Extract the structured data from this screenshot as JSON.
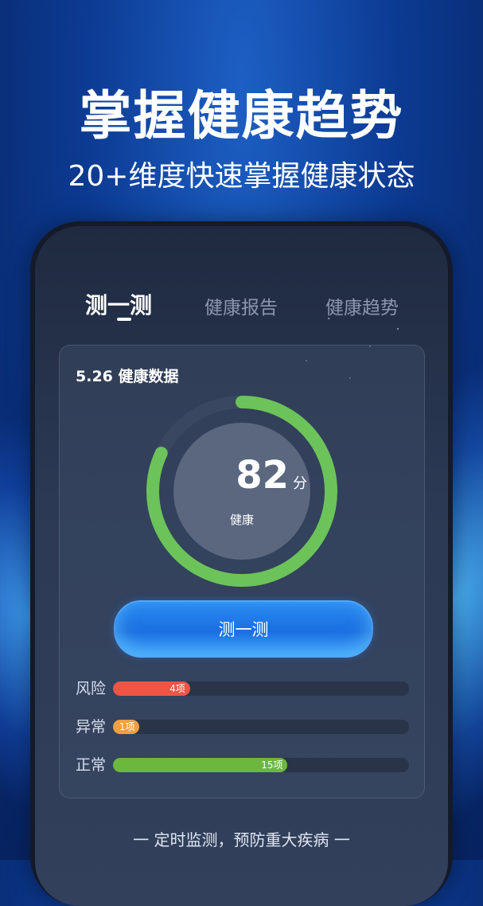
{
  "promo": {
    "headline": "掌握健康趋势",
    "subline": "20+维度快速掌握健康状态"
  },
  "tabs": [
    {
      "label": "测一测",
      "active": true
    },
    {
      "label": "健康报告",
      "active": false
    },
    {
      "label": "健康趋势",
      "active": false
    }
  ],
  "card": {
    "title": "5.26 健康数据",
    "score": {
      "value": "82",
      "unit": "分",
      "label": "健康",
      "fraction": 0.82,
      "color": "#6cc35a"
    },
    "test_button_label": "测一测",
    "bars": [
      {
        "label": "风险",
        "count_label": "4项",
        "fraction": 0.26,
        "color": "#ee5544"
      },
      {
        "label": "异常",
        "count_label": "1项",
        "fraction": 0.09,
        "color": "#f0a040"
      },
      {
        "label": "正常",
        "count_label": "15项",
        "fraction": 0.59,
        "color": "#6cb83e"
      }
    ]
  },
  "footer": "一 定时监测，预防重大疾病 一",
  "colors": {
    "accent_blue": "#1b6ee0",
    "gauge_green": "#6cc35a",
    "gauge_track": "#3a4760"
  }
}
